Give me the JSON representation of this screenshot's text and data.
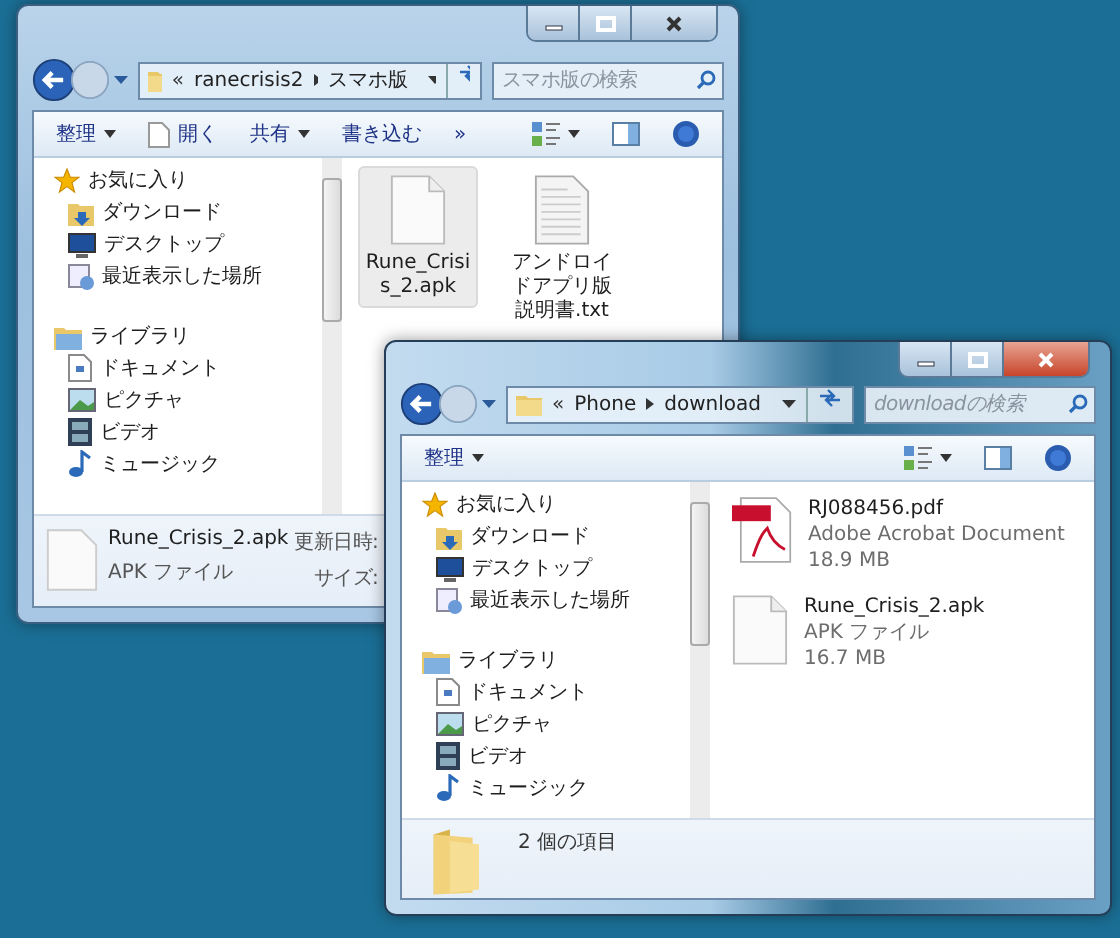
{
  "windows": [
    {
      "kind": "icons",
      "active": false,
      "address": {
        "overflow": "«",
        "crumbs": [
          "ranecrisis2",
          "スマホ版"
        ]
      },
      "search": {
        "placeholder": "スマホ版の検索"
      },
      "toolbar": [
        {
          "label": "整理",
          "kind": "menu"
        },
        {
          "label": "開く",
          "kind": "open"
        },
        {
          "label": "共有",
          "kind": "menu"
        },
        {
          "label": "書き込む",
          "kind": "plain"
        },
        {
          "label": "»",
          "kind": "plain"
        }
      ],
      "nav": [
        {
          "label": "お気に入り",
          "kind": "star",
          "children": [
            {
              "label": "ダウンロード",
              "kind": "download"
            },
            {
              "label": "デスクトップ",
              "kind": "desktop"
            },
            {
              "label": "最近表示した場所",
              "kind": "recent"
            }
          ]
        },
        {
          "label": "ライブラリ",
          "kind": "library",
          "children": [
            {
              "label": "ドキュメント",
              "kind": "document"
            },
            {
              "label": "ピクチャ",
              "kind": "picture"
            },
            {
              "label": "ビデオ",
              "kind": "video"
            },
            {
              "label": "ミュージック",
              "kind": "music"
            }
          ]
        }
      ],
      "files": [
        {
          "name": "Rune_Crisis_2.apk",
          "kind": "blank",
          "selected": true
        },
        {
          "name": "アンドロイドアプリ版説明書.txt",
          "kind": "text",
          "selected": false
        }
      ],
      "footer": {
        "kind": "details",
        "name": "Rune_Crisis_2.apk",
        "type": "APK ファイル",
        "labels": [
          "更新日時:",
          "サイズ:"
        ]
      }
    },
    {
      "kind": "tiles",
      "active": true,
      "address": {
        "overflow": "«",
        "crumbs": [
          "Phone",
          "download"
        ]
      },
      "search": {
        "placeholder": "downloadの検索"
      },
      "toolbar": [
        {
          "label": "整理",
          "kind": "menu"
        }
      ],
      "nav": [
        {
          "label": "お気に入り",
          "kind": "star",
          "children": [
            {
              "label": "ダウンロード",
              "kind": "download"
            },
            {
              "label": "デスクトップ",
              "kind": "desktop"
            },
            {
              "label": "最近表示した場所",
              "kind": "recent"
            }
          ]
        },
        {
          "label": "ライブラリ",
          "kind": "library",
          "children": [
            {
              "label": "ドキュメント",
              "kind": "document"
            },
            {
              "label": "ピクチャ",
              "kind": "picture"
            },
            {
              "label": "ビデオ",
              "kind": "video"
            },
            {
              "label": "ミュージック",
              "kind": "music"
            }
          ]
        }
      ],
      "files": [
        {
          "name": "RJ088456.pdf",
          "kind": "pdf",
          "type": "Adobe Acrobat Document",
          "size": "18.9 MB",
          "selected": false
        },
        {
          "name": "Rune_Crisis_2.apk",
          "kind": "blank",
          "type": "APK ファイル",
          "size": "16.7 MB",
          "selected": false
        }
      ],
      "footer": {
        "kind": "count",
        "text": "2 個の項目"
      }
    }
  ]
}
